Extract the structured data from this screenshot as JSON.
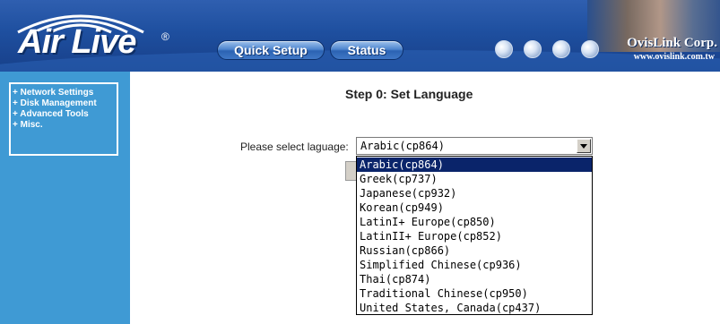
{
  "header": {
    "logo_text": "Air Live",
    "logo_reg": "®",
    "nav": [
      {
        "label": "Quick Setup"
      },
      {
        "label": "Status"
      }
    ],
    "brand": "OvisLink Corp.",
    "brand_url": "www.ovislink.com.tw"
  },
  "sidebar": {
    "items": [
      {
        "label": "+ Network Settings"
      },
      {
        "label": "+ Disk Management"
      },
      {
        "label": "+ Advanced Tools"
      },
      {
        "label": "+ Misc."
      }
    ]
  },
  "main": {
    "title": "Step 0: Set Language",
    "language_label": "Please select laguage:",
    "selected_value": "Arabic(cp864)",
    "options": [
      "Arabic(cp864)",
      "Greek(cp737)",
      "Japanese(cp932)",
      "Korean(cp949)",
      "LatinI+ Europe(cp850)",
      "LatinII+ Europe(cp852)",
      "Russian(cp866)",
      "Simplified Chinese(cp936)",
      "Thai(cp874)",
      "Traditional Chinese(cp950)",
      "United States, Canada(cp437)"
    ],
    "highlighted_index": 0
  },
  "colors": {
    "header_blue": "#1e4f9f",
    "sidebar_blue": "#3f9ad4",
    "selection_navy": "#0a246a"
  }
}
